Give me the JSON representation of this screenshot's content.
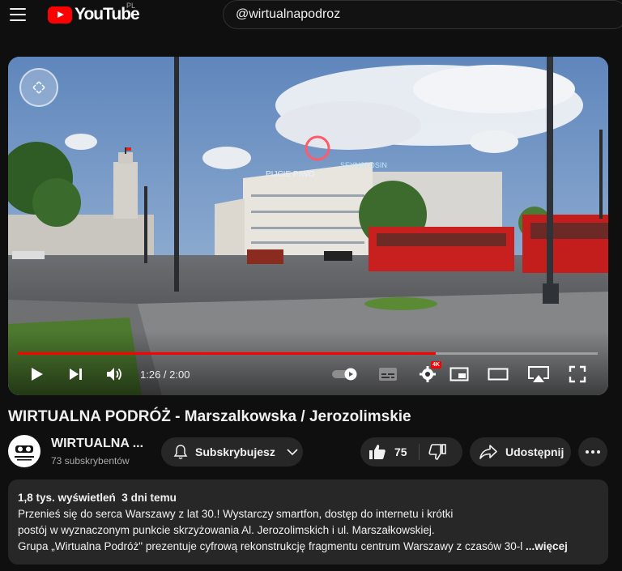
{
  "header": {
    "logo_text": "YouTube",
    "region": "PL",
    "search_value": "@wirtualnapodroz"
  },
  "player": {
    "time": "1:26 / 2:00",
    "progress": 0.72,
    "quality_badge": "4K",
    "icons": [
      "play-icon",
      "next-icon",
      "volume-icon",
      "autoplay-toggle-icon",
      "subtitles-icon",
      "settings-icon",
      "miniplayer-icon",
      "theater-icon",
      "airplay-icon",
      "fullscreen-icon"
    ]
  },
  "video": {
    "title": "WIRTUALNA PODRÓŻ - Marszalkowska / Jerozolimskie"
  },
  "channel": {
    "name": "WIRTUALNA ...",
    "subscribers": "73 subskrybentów",
    "avatar_text": "WIRTUALNA PODRÓŻ"
  },
  "actions": {
    "subscribe_label": "Subskrybujesz",
    "like_count": "75",
    "share_label": "Udostępnij"
  },
  "description": {
    "meta": "1,8 tys. wyświetleń  3 dni temu",
    "line1": "Przenieś się do serca Warszawy z lat 30.! Wystarczy smartfon, dostęp do internetu i krótki",
    "line2": "postój w wyznaczonym punkcie skrzyżowania Al. Jerozolimskich i ul. Marszałkowskiej.",
    "line3": "Grupa „Wirtualna Podróż\" prezentuje cyfrową rekonstrukcję fragmentu centrum Warszawy z czasów 30-l",
    "more_label": "...więcej"
  },
  "colors": {
    "accent": "#ff0000",
    "background": "#0f0f0f",
    "pill": "#272727"
  }
}
